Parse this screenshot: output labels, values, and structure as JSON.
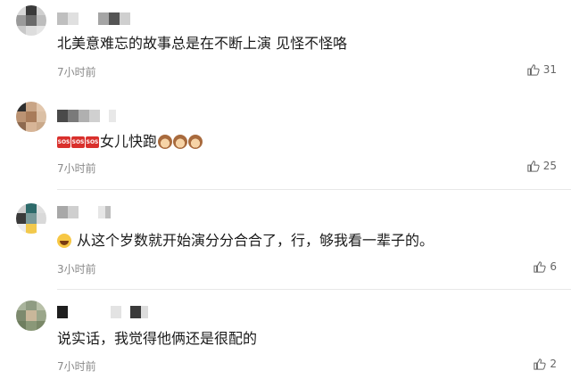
{
  "comments": [
    {
      "text": "北美意难忘的故事总是在不断上演 见怪不怪咯",
      "time": "7小时前",
      "likes": "31"
    },
    {
      "text": "女儿快跑",
      "emoji_prefix": [
        "sos-icon",
        "sos-icon",
        "sos-icon"
      ],
      "emoji_suffix": [
        "see-no-evil-monkey-icon",
        "see-no-evil-monkey-icon",
        "see-no-evil-monkey-icon"
      ],
      "time": "7小时前",
      "likes": "25"
    },
    {
      "text": "从这个岁数就开始演分分合合了，行，够我看一辈子的。",
      "emoji_prefix": [
        "laughing-face-icon"
      ],
      "time": "3小时前",
      "likes": "6"
    },
    {
      "text": "说实话，我觉得他俩还是很配的",
      "time": "7小时前",
      "likes": "2"
    }
  ],
  "colors": {
    "time_text": "#8a8a8a",
    "like_text": "#666666",
    "divider": "#e8e8e8",
    "sos_red": "#d9302c"
  },
  "sos_label": "SOS"
}
